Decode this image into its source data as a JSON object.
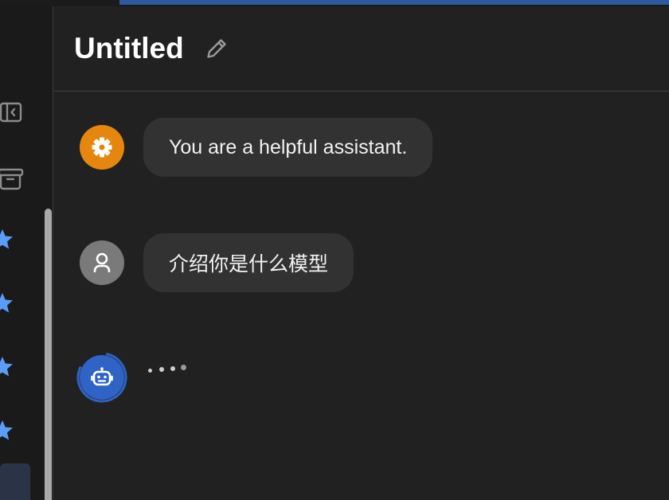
{
  "header": {
    "title": "Untitled"
  },
  "messages": [
    {
      "role": "system",
      "text": "You are a helpful assistant.",
      "avatar_icon": "gear-icon",
      "avatar_color": "#e5860f"
    },
    {
      "role": "user",
      "text": "介绍你是什么模型",
      "avatar_icon": "person-icon",
      "avatar_color": "#7a7a7a"
    },
    {
      "role": "assistant",
      "text": "",
      "avatar_icon": "robot-icon",
      "avatar_color": "#2f63c6",
      "status": "typing"
    }
  ],
  "sidebar": {
    "icons": [
      "sidebar-collapse-icon",
      "archive-icon"
    ],
    "star_count": 4,
    "star_color": "#5b9cf4"
  },
  "colors": {
    "background": "#212121",
    "bubble": "#323232"
  }
}
